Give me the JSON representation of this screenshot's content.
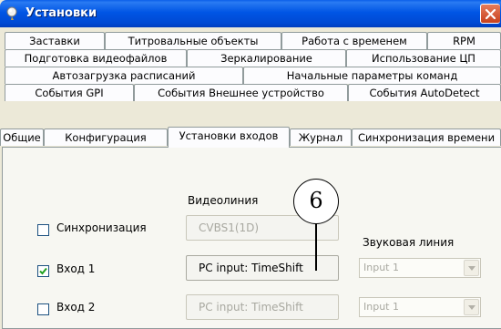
{
  "window": {
    "title": "Установки",
    "close_label": "close"
  },
  "tabs": {
    "row1": [
      "Заставки",
      "Титровальные объекты",
      "Работа с временем",
      "RPM"
    ],
    "row2": [
      "Подготовка видеофайлов",
      "Зеркалирование",
      "Использование ЦП"
    ],
    "row3": [
      "Автозагрузка расписаний",
      "Начальные параметры команд"
    ],
    "row4": [
      "События GPI",
      "События Внешнее устройство",
      "События AutoDetect"
    ],
    "row5": [
      "Общие",
      "Конфигурация",
      "Установки входов",
      "Журнал",
      "Синхронизация времени"
    ],
    "active": "Установки входов"
  },
  "panel": {
    "video_header": "Видеолиния",
    "audio_header": "Звуковая линия",
    "rows": [
      {
        "label": "Синхронизация",
        "checked": false,
        "video": "CVBS1(1D)",
        "video_enabled": false,
        "audio": ""
      },
      {
        "label": "Вход 1",
        "checked": true,
        "video": "PC input: TimeShift",
        "video_enabled": true,
        "audio": "Input 1"
      },
      {
        "label": "Вход 2",
        "checked": false,
        "video": "PC input: TimeShift",
        "video_enabled": false,
        "audio": "Input 1"
      }
    ]
  },
  "callout": {
    "number": "6"
  },
  "colors": {
    "titlebar": "#0055e5",
    "close": "#c8401d",
    "disabled_text": "#a8a8a0"
  }
}
